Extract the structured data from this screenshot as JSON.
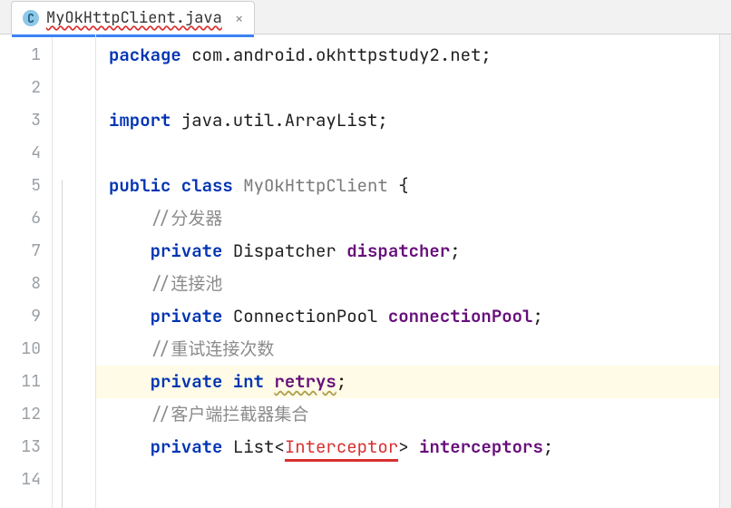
{
  "tab": {
    "icon_letter": "C",
    "filename": "MyOkHttpClient.java",
    "close_glyph": "×"
  },
  "gutter": {
    "start": 1,
    "end": 14
  },
  "code": {
    "l1_kw1": "package",
    "l1_rest": " com.android.okhttpstudy2.net;",
    "l3_kw1": "import",
    "l3_rest": " java.util.ArrayList;",
    "l5_kw1": "public class ",
    "l5_cls": "MyOkHttpClient",
    "l5_rest": " {",
    "l6_cmt": "//分发器",
    "l7_kw": "private ",
    "l7_type": "Dispatcher ",
    "l7_fld": "dispatcher",
    "l7_semi": ";",
    "l8_cmt": "//连接池",
    "l9_kw": "private ",
    "l9_type": "ConnectionPool ",
    "l9_fld": "connectionPool",
    "l9_semi": ";",
    "l10_cmt": "//重试连接次数",
    "l11_kw": "private int ",
    "l11_fld": "retrys",
    "l11_semi": ";",
    "l12_cmt": "//客户端拦截器集合",
    "l13_kw": "private ",
    "l13_type1": "List<",
    "l13_err": "Interceptor",
    "l13_type2": "> ",
    "l13_fld": "interceptors",
    "l13_semi": ";"
  }
}
